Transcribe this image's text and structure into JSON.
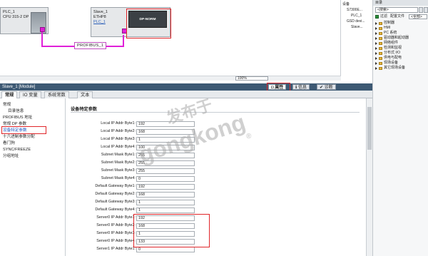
{
  "network": {
    "plc": {
      "name": "PLC_1",
      "type": "CPU 315-2 DP"
    },
    "slave": {
      "name": "Slave_1",
      "type": "ETHP8",
      "link": "PLC_1",
      "module": "DP-NORM"
    },
    "bus_label": "PROFIBUS_1",
    "zoom": "100%"
  },
  "overview": {
    "rows": [
      "设备",
      "S7300E...",
      "PLC_1",
      "GSD devi...",
      "Slave..."
    ]
  },
  "catalog": {
    "header": "目录",
    "search_placeholder": "<搜索>",
    "filter_label": "过滤",
    "profile_label": "配置文件",
    "profile_value": "<全部>",
    "items": [
      "控制器",
      "HMI",
      "PC 系统",
      "驱动器和起动器",
      "网络组件",
      "检测和监视",
      "分布式 I/O",
      "供电与配电",
      "现场设备",
      "其它现场设备"
    ]
  },
  "inspector": {
    "title": "Slave_1 [Module]",
    "tabs": [
      "属性",
      "信息",
      "诊断"
    ],
    "subtabs": [
      "常规",
      "IO 变量",
      "系统常数",
      "文本"
    ]
  },
  "leftnav": {
    "items": [
      "常规",
      "目录信息",
      "PROFIBUS 地址",
      "常规 DP 参数",
      "设备特定参数",
      "十六进制参数分配",
      "看门狗",
      "SYNC/FREEZE",
      "分组地址"
    ]
  },
  "params": {
    "title": "设备特定参数",
    "rows": [
      {
        "label": "Local IP Addr Byte1:",
        "value": "192"
      },
      {
        "label": "Local IP Addr Byte2:",
        "value": "168"
      },
      {
        "label": "Local IP Addr Byte3:",
        "value": "1"
      },
      {
        "label": "Local IP Addr Byte4:",
        "value": "100"
      },
      {
        "label": "Subnet Mask Byte1:",
        "value": "255"
      },
      {
        "label": "Subnet Mask Byte2:",
        "value": "255"
      },
      {
        "label": "Subnet Mask Byte3:",
        "value": "255"
      },
      {
        "label": "Subnet Mask Byte4:",
        "value": "0"
      },
      {
        "label": "Default Gateway Byte1:",
        "value": "192"
      },
      {
        "label": "Default Gateway Byte2:",
        "value": "168"
      },
      {
        "label": "Default Gateway Byte3:",
        "value": "1"
      },
      {
        "label": "Default Gateway Byte4:",
        "value": "1"
      },
      {
        "label": "Server0 IP Addr Byte1:",
        "value": "192"
      },
      {
        "label": "Server0 IP Addr Byte2:",
        "value": "168"
      },
      {
        "label": "Server0 IP Addr Byte3:",
        "value": "1"
      },
      {
        "label": "Server0 IP Addr Byte4:",
        "value": "133"
      },
      {
        "label": "Server1 IP Addr Byte1:",
        "value": "0"
      }
    ]
  },
  "watermark": {
    "cn": "发布于",
    "en": "gongkong",
    "mark": "®"
  },
  "colors": {
    "accent": "#e0262a",
    "bus": "#e020d8",
    "header": "#3d5973"
  }
}
